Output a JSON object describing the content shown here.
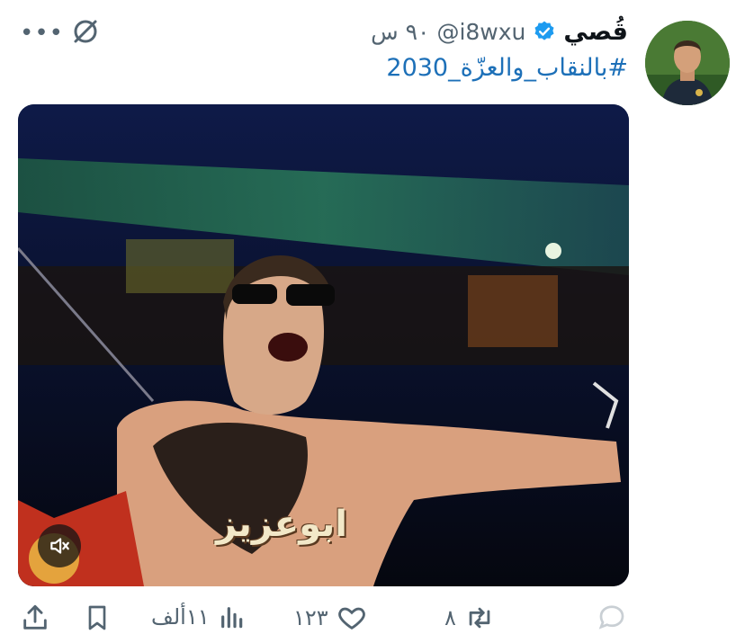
{
  "tweet": {
    "author_name": "قُصي",
    "handle": "@i8wxu",
    "time": "٩٠ س",
    "text": "#بالنقاب_والعزّة_2030",
    "media_caption": "ابوعزيز"
  },
  "actions": {
    "reply_count": "",
    "retweet_count": "٨",
    "like_count": "١٢٣",
    "views_count": "١١ألف"
  },
  "icons": {
    "verified": "verified-badge-icon",
    "grok": "grok-icon",
    "more": "more-icon",
    "sound": "speaker-icon",
    "reply": "reply-icon",
    "retweet": "retweet-icon",
    "like": "heart-icon",
    "views": "views-icon",
    "bookmark": "bookmark-icon",
    "share": "share-icon"
  },
  "colors": {
    "link": "#1d70b8",
    "verified": "#1d9bf0",
    "muted": "#536471"
  }
}
